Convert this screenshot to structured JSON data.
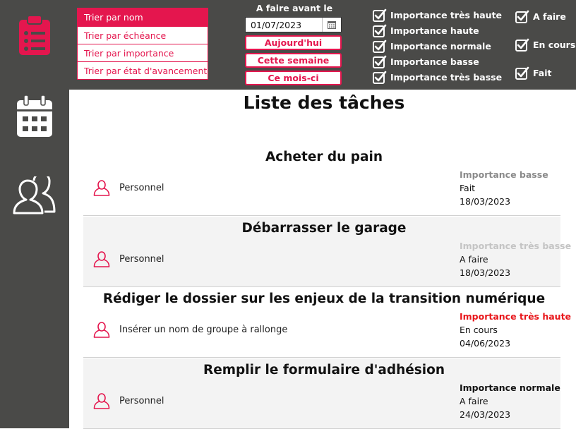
{
  "sort": {
    "options": [
      "Trier par nom",
      "Trier par échéance",
      "Trier par importance",
      "Trier par état d'avancement"
    ]
  },
  "date_filter": {
    "label": "A faire avant le",
    "value": "01/07/2023",
    "buttons": [
      "Aujourd'hui",
      "Cette semaine",
      "Ce mois-ci"
    ]
  },
  "importance_filters": [
    "Importance très haute",
    "Importance haute",
    "Importance normale",
    "Importance basse",
    "Importance très basse"
  ],
  "status_filters": [
    "A faire",
    "En cours",
    "Fait"
  ],
  "main": {
    "title": "Liste des tâches",
    "tasks": [
      {
        "title": "Acheter du pain",
        "group": "Personnel",
        "importance": "Importance basse",
        "status": "Fait",
        "date": "18/03/2023",
        "importance_color": "#8a8a8a"
      },
      {
        "title": "Débarrasser le garage",
        "group": "Personnel",
        "importance": "Importance très basse",
        "status": "A faire",
        "date": "18/03/2023",
        "importance_color": "#c4c4c4"
      },
      {
        "title": "Rédiger le dossier sur les enjeux de la transition numérique",
        "group": "Insérer un nom de groupe à rallonge",
        "importance": "Importance très haute",
        "status": "En cours",
        "date": "04/06/2023",
        "importance_color": "#e8161b"
      },
      {
        "title": "Remplir le formulaire d'adhésion",
        "group": "Personnel",
        "importance": "Importance normale",
        "status": "A faire",
        "date": "24/03/2023",
        "importance_color": "#111111"
      }
    ]
  },
  "colors": {
    "accent": "#e4164e",
    "panel": "#4a4a48"
  },
  "icons": {
    "nav": [
      "clipboard-list-icon",
      "calendar-icon",
      "users-icon"
    ],
    "task_user": "user-outline-icon",
    "check": "checkbox-checked-icon",
    "date_picker": "calendar-small-icon"
  }
}
